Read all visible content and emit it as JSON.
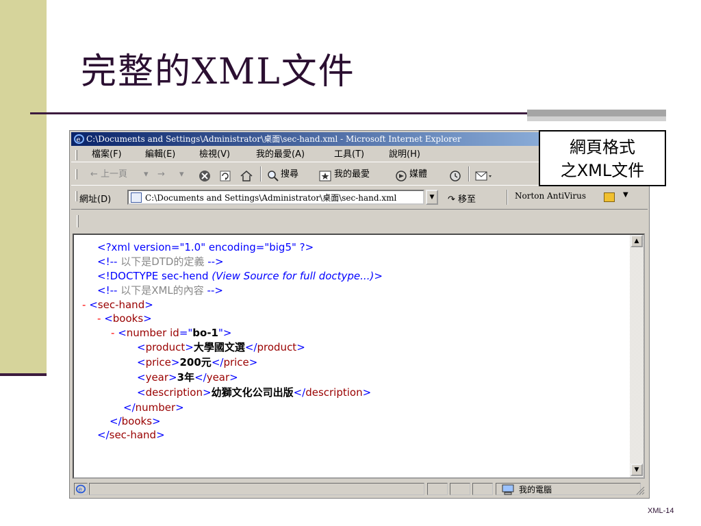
{
  "slide": {
    "title": "完整的XML文件",
    "number": "XML-14",
    "callout_line1": "網頁格式",
    "callout_line2": "之XML文件"
  },
  "colors": {
    "left_bar": "#d6d49b",
    "title_text": "#2b0f31",
    "rule": "#3c1b3e",
    "titlebar_start": "#0a246a",
    "xml_tag": "#990000",
    "xml_markup": "#0000ff",
    "xml_comment": "#888888",
    "xml_collapse": "#ff0000"
  },
  "browser": {
    "titlebar": "C:\\Documents and Settings\\Administrator\\桌面\\sec-hand.xml - Microsoft Internet Explorer",
    "menu": [
      "檔案(F)",
      "編輯(E)",
      "檢視(V)",
      "我的最愛(A)",
      "工具(T)",
      "說明(H)"
    ],
    "toolbar": {
      "back": "← 上一頁",
      "back_dropdown": "▾",
      "forward": "→",
      "forward_dropdown": "▾",
      "stop_icon": "stop-icon",
      "refresh_icon": "refresh-icon",
      "home_icon": "home-icon",
      "search": "搜尋",
      "favorites": "我的最愛",
      "media": "媒體",
      "history_icon": "history-icon",
      "mail_icon": "mail-icon"
    },
    "address": {
      "label": "網址(D)",
      "value": "C:\\Documents and Settings\\Administrator\\桌面\\sec-hand.xml",
      "go": "移至",
      "norton": "Norton AntiVirus"
    },
    "statusbar": {
      "zone": "我的電腦"
    }
  },
  "xml": {
    "decl": "<?xml version=\"1.0\" encoding=\"big5\" ?>",
    "comment1_open": "<!--",
    "comment1_text": " 以下是DTD的定義 ",
    "comment1_close": " -->",
    "doctype_open": "<!DOCTYPE sec-hend ",
    "doctype_note": "(View Source for full doctype...)",
    "doctype_close": ">",
    "comment2_open": "<!--",
    "comment2_text": " 以下是XML的內容 ",
    "comment2_close": " -->",
    "collapse": "-",
    "root_tag": "sec-hand",
    "books_tag": "books",
    "number_tag": "number",
    "number_attr": "id",
    "number_value": "bo-1",
    "product_tag": "product",
    "product_value": "大學國文選",
    "price_tag": "price",
    "price_value": "200元",
    "year_tag": "year",
    "year_value": "3年",
    "description_tag": "description",
    "description_value": "幼獅文化公司出版"
  }
}
